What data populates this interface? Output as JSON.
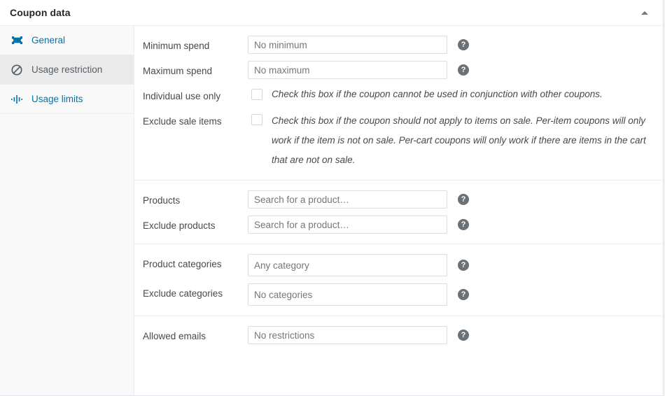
{
  "panel": {
    "title": "Coupon data",
    "toggle_icon": "caret-up-icon"
  },
  "tabs": [
    {
      "id": "general",
      "label": "General",
      "icon": "ticket-icon",
      "active": false
    },
    {
      "id": "usage-restriction",
      "label": "Usage restriction",
      "icon": "no-entry-icon",
      "active": true
    },
    {
      "id": "usage-limits",
      "label": "Usage limits",
      "icon": "usage-limits-icon",
      "active": false
    }
  ],
  "groups": [
    {
      "id": "spend-and-flags",
      "rows": [
        {
          "id": "minimum-spend",
          "type": "text",
          "label": "Minimum spend",
          "value": "",
          "placeholder": "No minimum",
          "help": "?"
        },
        {
          "id": "maximum-spend",
          "type": "text",
          "label": "Maximum spend",
          "value": "",
          "placeholder": "No maximum",
          "help": "?"
        },
        {
          "id": "individual-use-only",
          "type": "checkbox",
          "label": "Individual use only",
          "checked": false,
          "description": "Check this box if the coupon cannot be used in conjunction with other coupons."
        },
        {
          "id": "exclude-sale-items",
          "type": "checkbox",
          "label": "Exclude sale items",
          "checked": false,
          "description": "Check this box if the coupon should not apply to items on sale. Per-item coupons will only work if the item is not on sale. Per-cart coupons will only work if there are items in the cart that are not on sale."
        }
      ]
    },
    {
      "id": "products",
      "rows": [
        {
          "id": "products",
          "type": "text",
          "label": "Products",
          "value": "",
          "placeholder": "Search for a product…",
          "help": "?"
        },
        {
          "id": "exclude-products",
          "type": "text",
          "label": "Exclude products",
          "value": "",
          "placeholder": "Search for a product…",
          "help": "?"
        }
      ]
    },
    {
      "id": "categories",
      "rows": [
        {
          "id": "product-categories",
          "type": "text",
          "tall": true,
          "label": "Product categories",
          "value": "",
          "placeholder": "Any category",
          "help": "?"
        },
        {
          "id": "exclude-categories",
          "type": "text",
          "tall": true,
          "label": "Exclude categories",
          "value": "",
          "placeholder": "No categories",
          "help": "?"
        }
      ]
    },
    {
      "id": "emails",
      "rows": [
        {
          "id": "allowed-emails",
          "type": "text",
          "label": "Allowed emails",
          "value": "",
          "placeholder": "No restrictions",
          "help": "?"
        }
      ]
    }
  ],
  "colors": {
    "link": "#0073aa",
    "panel_bg": "#ffffff",
    "sidebar_bg": "#f9f9f9",
    "active_tab_bg": "#eaeaea",
    "border": "#eeeeee",
    "title_text": "#23282d",
    "label_text": "#444a4f",
    "placeholder_text": "#72777c",
    "help_bubble": "#6c7175",
    "page_bg": "#f1f1f1"
  }
}
